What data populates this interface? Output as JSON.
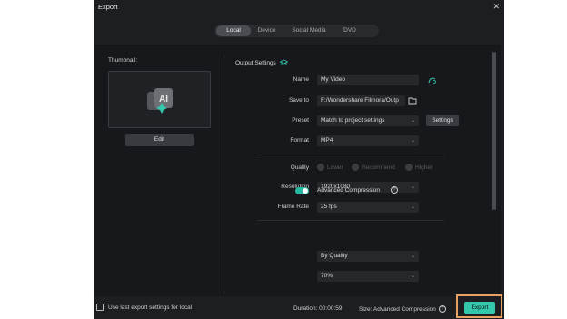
{
  "window": {
    "title": "Export",
    "close_glyph": "✕"
  },
  "tabs": [
    {
      "label": "Local",
      "active": true
    },
    {
      "label": "Device",
      "active": false
    },
    {
      "label": "Social Media",
      "active": false
    },
    {
      "label": "DVD",
      "active": false
    }
  ],
  "thumbnail": {
    "label": "Thumbnail:",
    "edit_label": "Edit",
    "icon": "ai-thumbnail-icon"
  },
  "output_settings": {
    "title": "Output Settings",
    "name": {
      "label": "Name",
      "value": "My Video"
    },
    "save_to": {
      "label": "Save to",
      "value": "F:/Wondershare Filmora/Outp"
    },
    "preset": {
      "label": "Preset",
      "value": "Match to project settings",
      "settings_label": "Settings"
    },
    "format": {
      "label": "Format",
      "value": "MP4"
    },
    "quality": {
      "label": "Quality",
      "options": [
        "Lower",
        "Recommend",
        "Higher"
      ]
    },
    "resolution": {
      "label": "Resolution",
      "value": "1920x1080"
    },
    "frame_rate": {
      "label": "Frame Rate",
      "value": "25 fps"
    },
    "advanced_compression": {
      "label": "Advanced Compression",
      "enabled": true,
      "mode": "By Quality",
      "percent": "70%"
    }
  },
  "footer": {
    "checkbox_label": "Use last export settings for local",
    "duration": "Duration: 00:00:59",
    "size": "Size: Advanced Compression",
    "help_glyph": "?",
    "export_label": "Export"
  },
  "colors": {
    "accent": "#34c8ae",
    "highlight": "#e8a060",
    "dialog_bg": "#1d1e22"
  }
}
